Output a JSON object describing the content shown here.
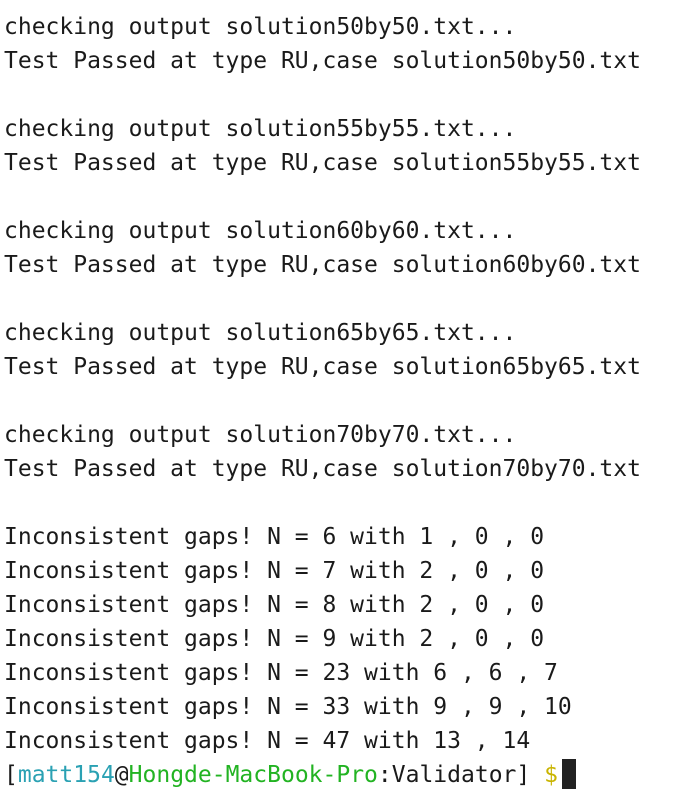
{
  "output": {
    "blocks": [
      {
        "check": "checking output solution50by50.txt...",
        "result": "Test Passed at type RU,case solution50by50.txt"
      },
      {
        "check": "checking output solution55by55.txt...",
        "result": "Test Passed at type RU,case solution55by55.txt"
      },
      {
        "check": "checking output solution60by60.txt...",
        "result": "Test Passed at type RU,case solution60by60.txt"
      },
      {
        "check": "checking output solution65by65.txt...",
        "result": "Test Passed at type RU,case solution65by65.txt"
      },
      {
        "check": "checking output solution70by70.txt...",
        "result": "Test Passed at type RU,case solution70by70.txt"
      }
    ],
    "gaps": [
      "Inconsistent gaps! N = 6 with 1 , 0 , 0",
      "Inconsistent gaps! N = 7 with 2 , 0 , 0",
      "Inconsistent gaps! N = 8 with 2 , 0 , 0",
      "Inconsistent gaps! N = 9 with 2 , 0 , 0",
      "Inconsistent gaps! N = 23 with 6 , 6 , 7",
      "Inconsistent gaps! N = 33 with 9 , 9 , 10",
      "Inconsistent gaps! N = 47 with 13 , 14"
    ]
  },
  "prompt": {
    "open_bracket": "[",
    "user": "matt154",
    "at": "@",
    "host": "Hongde-MacBook-Pro",
    "colon": ":",
    "dir": "Validator",
    "close_bracket": "]",
    "dollar": "$"
  },
  "colors": {
    "user": "#2aa1b3",
    "host": "#22b322",
    "dollar": "#c9b400"
  }
}
